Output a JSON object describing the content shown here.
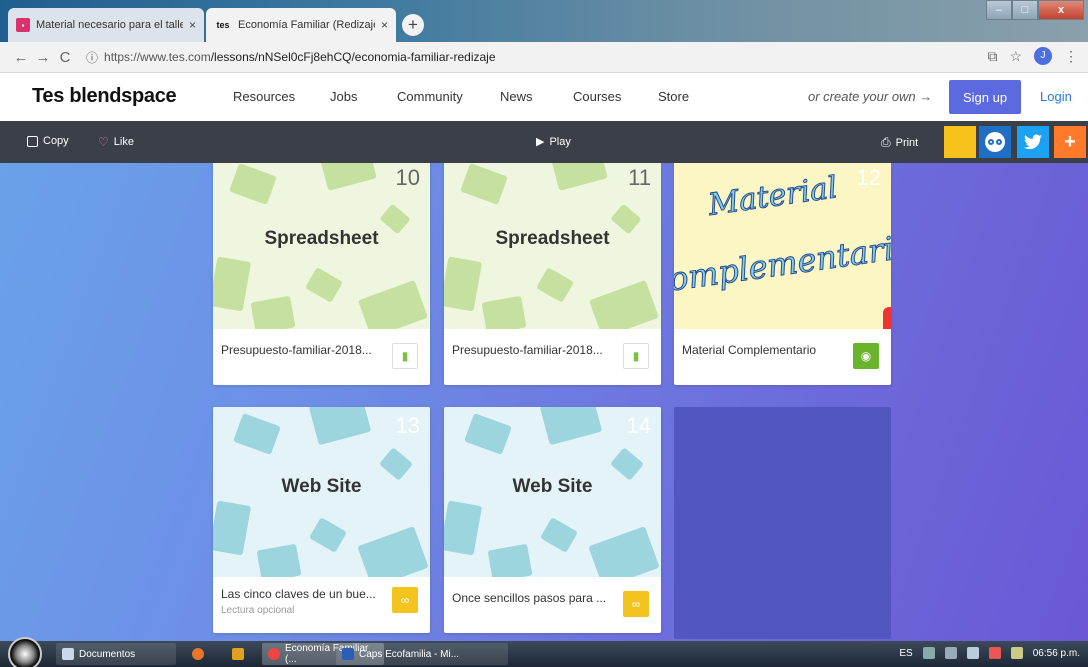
{
  "browser": {
    "tabs": [
      {
        "title": "Material necesario para el taller: ",
        "favicon": "pink-square-icon"
      },
      {
        "title": "Economía Familiar (Redizaje) - Le",
        "favicon": "tes-icon"
      }
    ],
    "favicon_tes_text": "tes",
    "close_glyph": "×",
    "new_tab_glyph": "+",
    "url_scheme_host": "https://www.tes.com",
    "url_path": "/lessons/nNSel0cFj8ehCQ/economia-familiar-redizaje",
    "profile_initial": "J",
    "window_controls": {
      "min": "–",
      "max": "□",
      "close": "x"
    }
  },
  "site": {
    "logo": "Tes blendspace",
    "nav": [
      "Resources",
      "Jobs",
      "Community",
      "News",
      "Courses",
      "Store"
    ],
    "create_own": "or create your own →",
    "signup": "Sign up",
    "login": "Login"
  },
  "toolbar": {
    "copy": "Copy",
    "like": "Like",
    "play": "Play",
    "print": "Print"
  },
  "cards": [
    {
      "number": "10",
      "thumb_label": "Spreadsheet",
      "title": "Presupuesto-familiar-2018...",
      "subtitle": "",
      "icon": "document-icon"
    },
    {
      "number": "11",
      "thumb_label": "Spreadsheet",
      "title": "Presupuesto-familiar-2018...",
      "subtitle": "",
      "icon": "document-icon"
    },
    {
      "number": "12",
      "thumb_label": "",
      "title": "Material Complementario",
      "subtitle": "",
      "icon": "camera-icon",
      "image_text_1": "Material",
      "image_text_2": "omplementari"
    },
    {
      "number": "13",
      "thumb_label": "Web Site",
      "title": "Las cinco claves de un bue...",
      "subtitle": "Lectura opcional",
      "icon": "link-icon"
    },
    {
      "number": "14",
      "thumb_label": "Web Site",
      "title": "Once sencillos pasos para ...",
      "subtitle": "",
      "icon": "link-icon"
    }
  ],
  "taskbar": {
    "items": [
      "Documentos",
      "Economía Familiar (...",
      "Caps Ecofamilia - Mi..."
    ],
    "lang": "ES",
    "clock": "06:56 p.m."
  },
  "colors": {
    "signup_bg": "#5c6ae0",
    "toolbar_bg": "#3a3f48",
    "link_icon_bg": "#f3c31e",
    "camera_icon_bg": "#6ab42d"
  }
}
